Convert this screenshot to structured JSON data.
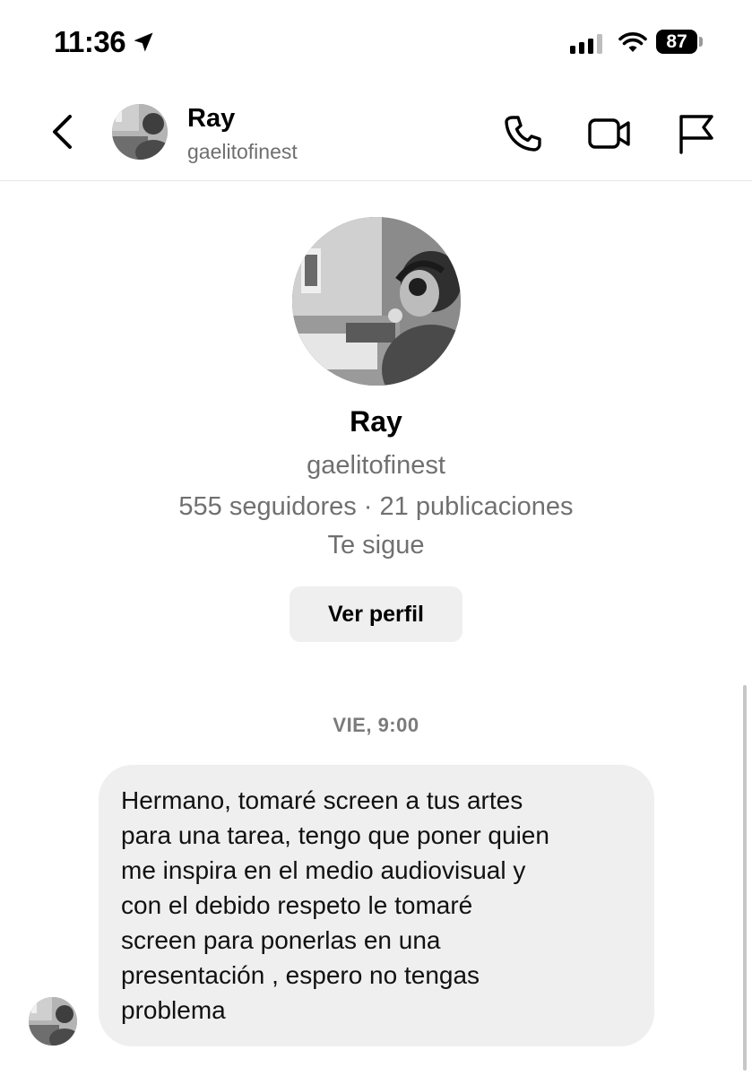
{
  "status_bar": {
    "time": "11:36",
    "battery": "87",
    "icons": [
      "location-arrow-icon",
      "cellular-signal-icon",
      "wifi-icon",
      "battery-icon"
    ]
  },
  "header": {
    "name": "Ray",
    "username": "gaelitofinest",
    "icons": [
      "back-chevron-icon",
      "phone-icon",
      "video-camera-icon",
      "flag-icon"
    ]
  },
  "profile": {
    "name": "Ray",
    "username": "gaelitofinest",
    "stats": "555 seguidores · 21 publicaciones",
    "follows_you": "Te sigue",
    "view_profile_label": "Ver perfil"
  },
  "conversation": {
    "date_divider": "VIE, 9:00",
    "messages": [
      {
        "sender": "Ray",
        "text": "Hermano, tomaré screen a tus artes\npara una tarea, tengo que poner quien\nme inspira en el medio audiovisual y\ncon el debido respeto le tomaré\nscreen para ponerlas en una\npresentación , espero no tengas\nproblema"
      }
    ]
  },
  "colors": {
    "background": "#ffffff",
    "bubble": "#efefef",
    "secondary_text": "#707070",
    "button": "#efefef"
  }
}
